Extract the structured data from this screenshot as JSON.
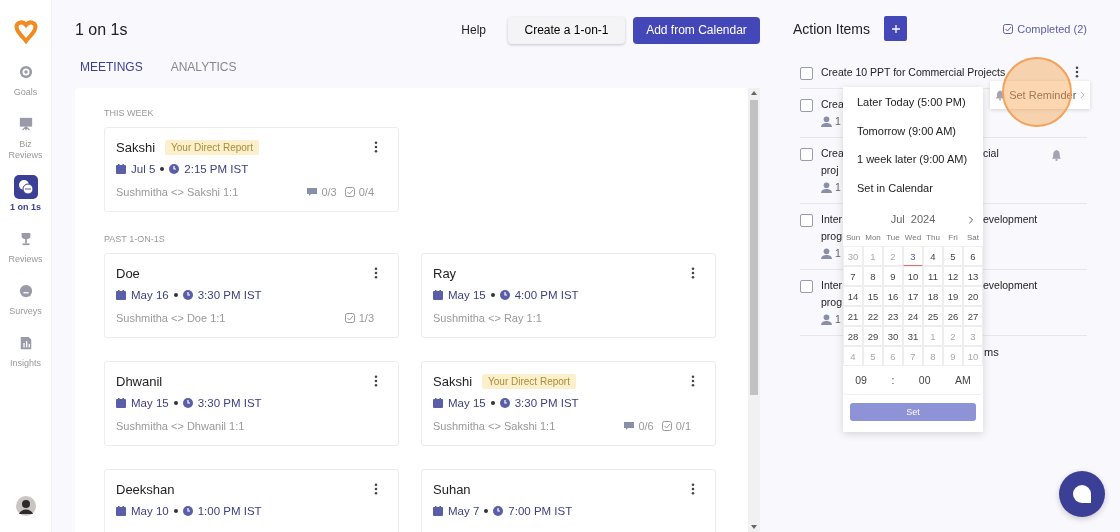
{
  "sidebar": {
    "items": [
      {
        "label": "Goals",
        "selected": false
      },
      {
        "label": "Biz Reviews",
        "selected": false
      },
      {
        "label": "1 on 1s",
        "selected": true
      },
      {
        "label": "Reviews",
        "selected": false
      },
      {
        "label": "Surveys",
        "selected": false
      },
      {
        "label": "Insights",
        "selected": false
      }
    ]
  },
  "header": {
    "title": "1 on 1s",
    "help": "Help",
    "create_button": "Create a 1-on-1",
    "calendar_button": "Add from Calendar"
  },
  "tabs": [
    {
      "label": "MEETINGS",
      "selected": true
    },
    {
      "label": "ANALYTICS",
      "selected": false
    }
  ],
  "sections": [
    {
      "label": "THIS WEEK",
      "cards": [
        {
          "name": "Sakshi",
          "badge": "Your Direct Report",
          "date": "Jul 5",
          "time": "2:15 PM IST",
          "subtitle": "Sushmitha <> Sakshi 1:1",
          "comments": "0/3",
          "actions": "0/4"
        }
      ]
    },
    {
      "label": "PAST 1-ON-1S",
      "cards": [
        {
          "name": "Doe",
          "date": "May 16",
          "time": "3:30 PM IST",
          "subtitle": "Sushmitha <> Doe 1:1",
          "actions": "1/3"
        },
        {
          "name": "Ray",
          "date": "May 15",
          "time": "4:00 PM IST",
          "subtitle": "Sushmitha <> Ray 1:1"
        },
        {
          "name": "Dhwanil",
          "date": "May 15",
          "time": "3:30 PM IST",
          "subtitle": "Sushmitha <> Dhwanil 1:1"
        },
        {
          "name": "Sakshi",
          "badge": "Your Direct Report",
          "date": "May 15",
          "time": "3:30 PM IST",
          "subtitle": "Sushmitha <> Sakshi 1:1",
          "comments": "0/6",
          "actions": "0/1"
        },
        {
          "name": "Deekshan",
          "date": "May 10",
          "time": "1:00 PM IST"
        },
        {
          "name": "Suhan",
          "date": "May 7",
          "time": "7:00 PM IST"
        }
      ]
    }
  ],
  "action_items": {
    "title": "Action Items",
    "completed": "Completed (2)",
    "items": [
      {
        "checked": false,
        "lines": [
          [
            "Create 10 PPT for Commercial Projects"
          ]
        ],
        "menu": true
      },
      {
        "checked": false,
        "lines": [
          [
            "Crea"
          ]
        ],
        "assignee": "1"
      },
      {
        "checked": false,
        "lines": [
          [
            "Crea",
            "cial"
          ],
          [
            "proj"
          ]
        ],
        "assignee": "1",
        "reminder": true
      },
      {
        "checked": false,
        "lines": [
          [
            "Inter",
            "evelopment"
          ],
          [
            "prog"
          ]
        ],
        "assignee": "1"
      },
      {
        "checked": false,
        "lines": [
          [
            "Inter",
            "evelopment"
          ],
          [
            "prog"
          ]
        ],
        "assignee": "1"
      }
    ],
    "more_text": "ms"
  },
  "reminder_menu": {
    "label": "Set Reminder"
  },
  "reminder_popup": {
    "options": [
      "Later Today (5:00 PM)",
      "Tomorrow (9:00 AM)",
      "1 week later (9:00 AM)",
      "Set in Calendar"
    ],
    "calendar": {
      "month": "Jul",
      "year": "2024",
      "weekdays": [
        "Sun",
        "Mon",
        "Tue",
        "Wed",
        "Thu",
        "Fri",
        "Sat"
      ],
      "days": [
        {
          "d": "30",
          "outside": true,
          "today": false
        },
        {
          "d": "1",
          "outside": true,
          "today": false
        },
        {
          "d": "2",
          "outside": true,
          "today": false
        },
        {
          "d": "3",
          "outside": false,
          "today": true
        },
        {
          "d": "4",
          "outside": false,
          "today": false
        },
        {
          "d": "5",
          "outside": false,
          "today": false
        },
        {
          "d": "6",
          "outside": false,
          "today": false
        },
        {
          "d": "7",
          "outside": false,
          "today": false
        },
        {
          "d": "8",
          "outside": false,
          "today": false
        },
        {
          "d": "9",
          "outside": false,
          "today": false
        },
        {
          "d": "10",
          "outside": false,
          "today": false
        },
        {
          "d": "11",
          "outside": false,
          "today": false
        },
        {
          "d": "12",
          "outside": false,
          "today": false
        },
        {
          "d": "13",
          "outside": false,
          "today": false
        },
        {
          "d": "14",
          "outside": false,
          "today": false
        },
        {
          "d": "15",
          "outside": false,
          "today": false
        },
        {
          "d": "16",
          "outside": false,
          "today": false
        },
        {
          "d": "17",
          "outside": false,
          "today": false
        },
        {
          "d": "18",
          "outside": false,
          "today": false
        },
        {
          "d": "19",
          "outside": false,
          "today": false
        },
        {
          "d": "20",
          "outside": false,
          "today": false
        },
        {
          "d": "21",
          "outside": false,
          "today": false
        },
        {
          "d": "22",
          "outside": false,
          "today": false
        },
        {
          "d": "23",
          "outside": false,
          "today": false
        },
        {
          "d": "24",
          "outside": false,
          "today": false
        },
        {
          "d": "25",
          "outside": false,
          "today": false
        },
        {
          "d": "26",
          "outside": false,
          "today": false
        },
        {
          "d": "27",
          "outside": false,
          "today": false
        },
        {
          "d": "28",
          "outside": false,
          "today": false
        },
        {
          "d": "29",
          "outside": false,
          "today": false
        },
        {
          "d": "30",
          "outside": false,
          "today": false
        },
        {
          "d": "31",
          "outside": false,
          "today": false
        },
        {
          "d": "1",
          "outside": true,
          "today": false
        },
        {
          "d": "2",
          "outside": true,
          "today": false
        },
        {
          "d": "3",
          "outside": true,
          "today": false
        },
        {
          "d": "4",
          "outside": true,
          "today": false
        },
        {
          "d": "5",
          "outside": true,
          "today": false
        },
        {
          "d": "6",
          "outside": true,
          "today": false
        },
        {
          "d": "7",
          "outside": true,
          "today": false
        },
        {
          "d": "8",
          "outside": true,
          "today": false
        },
        {
          "d": "9",
          "outside": true,
          "today": false
        },
        {
          "d": "10",
          "outside": true,
          "today": false
        }
      ]
    },
    "hour": "09",
    "separator": ":",
    "minute": "00",
    "meridiem": "AM",
    "set_button": "Set"
  }
}
